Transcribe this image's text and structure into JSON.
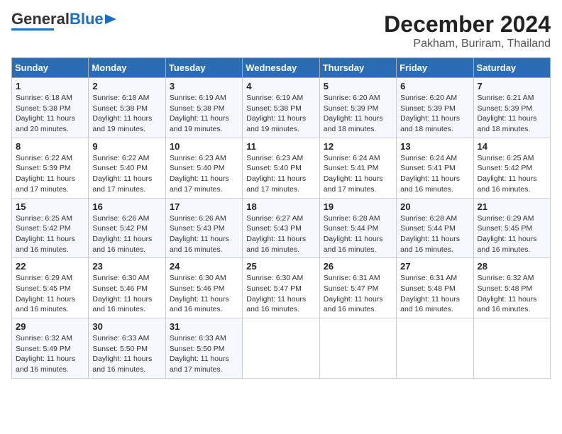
{
  "header": {
    "logo_line1": "General",
    "logo_line2": "Blue",
    "title": "December 2024",
    "subtitle": "Pakham, Buriram, Thailand"
  },
  "calendar": {
    "days_of_week": [
      "Sunday",
      "Monday",
      "Tuesday",
      "Wednesday",
      "Thursday",
      "Friday",
      "Saturday"
    ],
    "weeks": [
      [
        {
          "day": "1",
          "detail": "Sunrise: 6:18 AM\nSunset: 5:38 PM\nDaylight: 11 hours\nand 20 minutes."
        },
        {
          "day": "2",
          "detail": "Sunrise: 6:18 AM\nSunset: 5:38 PM\nDaylight: 11 hours\nand 19 minutes."
        },
        {
          "day": "3",
          "detail": "Sunrise: 6:19 AM\nSunset: 5:38 PM\nDaylight: 11 hours\nand 19 minutes."
        },
        {
          "day": "4",
          "detail": "Sunrise: 6:19 AM\nSunset: 5:38 PM\nDaylight: 11 hours\nand 19 minutes."
        },
        {
          "day": "5",
          "detail": "Sunrise: 6:20 AM\nSunset: 5:39 PM\nDaylight: 11 hours\nand 18 minutes."
        },
        {
          "day": "6",
          "detail": "Sunrise: 6:20 AM\nSunset: 5:39 PM\nDaylight: 11 hours\nand 18 minutes."
        },
        {
          "day": "7",
          "detail": "Sunrise: 6:21 AM\nSunset: 5:39 PM\nDaylight: 11 hours\nand 18 minutes."
        }
      ],
      [
        {
          "day": "8",
          "detail": "Sunrise: 6:22 AM\nSunset: 5:39 PM\nDaylight: 11 hours\nand 17 minutes."
        },
        {
          "day": "9",
          "detail": "Sunrise: 6:22 AM\nSunset: 5:40 PM\nDaylight: 11 hours\nand 17 minutes."
        },
        {
          "day": "10",
          "detail": "Sunrise: 6:23 AM\nSunset: 5:40 PM\nDaylight: 11 hours\nand 17 minutes."
        },
        {
          "day": "11",
          "detail": "Sunrise: 6:23 AM\nSunset: 5:40 PM\nDaylight: 11 hours\nand 17 minutes."
        },
        {
          "day": "12",
          "detail": "Sunrise: 6:24 AM\nSunset: 5:41 PM\nDaylight: 11 hours\nand 17 minutes."
        },
        {
          "day": "13",
          "detail": "Sunrise: 6:24 AM\nSunset: 5:41 PM\nDaylight: 11 hours\nand 16 minutes."
        },
        {
          "day": "14",
          "detail": "Sunrise: 6:25 AM\nSunset: 5:42 PM\nDaylight: 11 hours\nand 16 minutes."
        }
      ],
      [
        {
          "day": "15",
          "detail": "Sunrise: 6:25 AM\nSunset: 5:42 PM\nDaylight: 11 hours\nand 16 minutes."
        },
        {
          "day": "16",
          "detail": "Sunrise: 6:26 AM\nSunset: 5:42 PM\nDaylight: 11 hours\nand 16 minutes."
        },
        {
          "day": "17",
          "detail": "Sunrise: 6:26 AM\nSunset: 5:43 PM\nDaylight: 11 hours\nand 16 minutes."
        },
        {
          "day": "18",
          "detail": "Sunrise: 6:27 AM\nSunset: 5:43 PM\nDaylight: 11 hours\nand 16 minutes."
        },
        {
          "day": "19",
          "detail": "Sunrise: 6:28 AM\nSunset: 5:44 PM\nDaylight: 11 hours\nand 16 minutes."
        },
        {
          "day": "20",
          "detail": "Sunrise: 6:28 AM\nSunset: 5:44 PM\nDaylight: 11 hours\nand 16 minutes."
        },
        {
          "day": "21",
          "detail": "Sunrise: 6:29 AM\nSunset: 5:45 PM\nDaylight: 11 hours\nand 16 minutes."
        }
      ],
      [
        {
          "day": "22",
          "detail": "Sunrise: 6:29 AM\nSunset: 5:45 PM\nDaylight: 11 hours\nand 16 minutes."
        },
        {
          "day": "23",
          "detail": "Sunrise: 6:30 AM\nSunset: 5:46 PM\nDaylight: 11 hours\nand 16 minutes."
        },
        {
          "day": "24",
          "detail": "Sunrise: 6:30 AM\nSunset: 5:46 PM\nDaylight: 11 hours\nand 16 minutes."
        },
        {
          "day": "25",
          "detail": "Sunrise: 6:30 AM\nSunset: 5:47 PM\nDaylight: 11 hours\nand 16 minutes."
        },
        {
          "day": "26",
          "detail": "Sunrise: 6:31 AM\nSunset: 5:47 PM\nDaylight: 11 hours\nand 16 minutes."
        },
        {
          "day": "27",
          "detail": "Sunrise: 6:31 AM\nSunset: 5:48 PM\nDaylight: 11 hours\nand 16 minutes."
        },
        {
          "day": "28",
          "detail": "Sunrise: 6:32 AM\nSunset: 5:48 PM\nDaylight: 11 hours\nand 16 minutes."
        }
      ],
      [
        {
          "day": "29",
          "detail": "Sunrise: 6:32 AM\nSunset: 5:49 PM\nDaylight: 11 hours\nand 16 minutes."
        },
        {
          "day": "30",
          "detail": "Sunrise: 6:33 AM\nSunset: 5:50 PM\nDaylight: 11 hours\nand 16 minutes."
        },
        {
          "day": "31",
          "detail": "Sunrise: 6:33 AM\nSunset: 5:50 PM\nDaylight: 11 hours\nand 17 minutes."
        },
        {
          "day": "",
          "detail": ""
        },
        {
          "day": "",
          "detail": ""
        },
        {
          "day": "",
          "detail": ""
        },
        {
          "day": "",
          "detail": ""
        }
      ]
    ]
  }
}
